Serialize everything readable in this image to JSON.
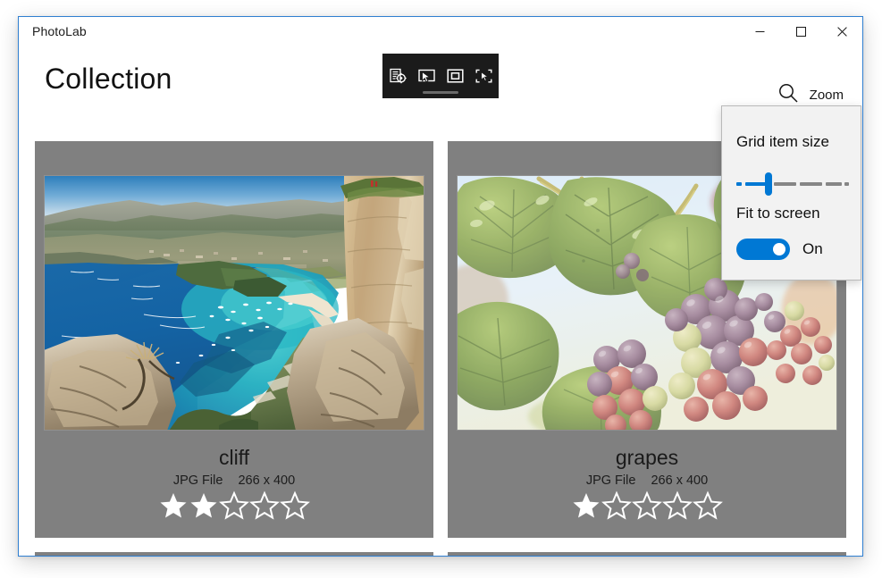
{
  "window": {
    "app_title": "PhotoLab",
    "accent_color": "#0078d4",
    "border_color": "#2f7fd1",
    "caption_buttons": [
      {
        "name": "minimize",
        "glyph": "minimize-icon"
      },
      {
        "name": "maximize",
        "glyph": "maximize-icon"
      },
      {
        "name": "close",
        "glyph": "close-icon"
      }
    ]
  },
  "header": {
    "page_title": "Collection",
    "zoom_command": {
      "label": "Zoom",
      "icon": "search-icon"
    }
  },
  "vs_toolbar": {
    "buttons": [
      {
        "name": "go-to-live-visual-tree",
        "icon": "live-visual-tree-icon",
        "tooltip": "Go to Live Visual Tree"
      },
      {
        "name": "enable-selection",
        "icon": "select-element-icon",
        "tooltip": "Enable selection"
      },
      {
        "name": "display-layout-adorners",
        "icon": "layout-adorners-icon",
        "tooltip": "Display layout adorners"
      },
      {
        "name": "track-focused-element",
        "icon": "track-focus-icon",
        "tooltip": "Track focused element"
      }
    ],
    "drag_handle": "drag-handle"
  },
  "zoom_flyout": {
    "grid_item_size": {
      "label": "Grid item size",
      "value_percent": 27,
      "tick_count": 6
    },
    "fit_to_screen": {
      "label": "Fit to screen",
      "state_label": "On",
      "checked": true
    }
  },
  "grid": {
    "card_background": "#808080",
    "items": [
      {
        "name": "cliff",
        "title": "cliff",
        "file_type": "JPG File",
        "dimensions": "266 x 400",
        "rating": 2,
        "rating_max": 5,
        "photo": "coastal-cliff-bay-photo"
      },
      {
        "name": "grapes",
        "title": "grapes",
        "file_type": "JPG File",
        "dimensions": "266 x 400",
        "rating": 1,
        "rating_max": 5,
        "photo": "grape-vine-photo"
      }
    ],
    "partial_row_placeholders": 2
  }
}
